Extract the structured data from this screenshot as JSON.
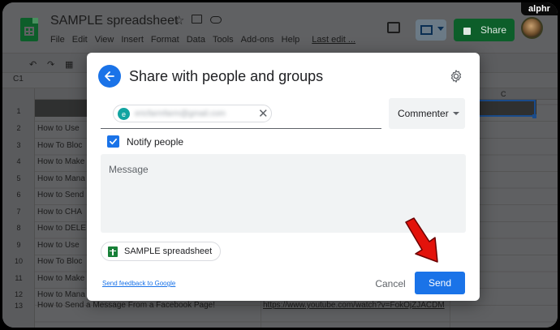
{
  "app": {
    "doc_title": "SAMPLE spreadsheet",
    "menu": [
      "File",
      "Edit",
      "View",
      "Insert",
      "Format",
      "Data",
      "Tools",
      "Add-ons",
      "Help"
    ],
    "last_edit": "Last edit ...",
    "share_label": "Share",
    "cell_ref": "C1",
    "badge": "alphr"
  },
  "sheet": {
    "column_c": "C",
    "rows": [
      {
        "num": "1",
        "text": ""
      },
      {
        "num": "2",
        "text": "How to Use"
      },
      {
        "num": "3",
        "text": "How To Bloc"
      },
      {
        "num": "4",
        "text": "How to Make"
      },
      {
        "num": "5",
        "text": "How to Mana"
      },
      {
        "num": "6",
        "text": "How to Send"
      },
      {
        "num": "7",
        "text": "How to CHA"
      },
      {
        "num": "8",
        "text": "How to DELE"
      },
      {
        "num": "9",
        "text": "How to Use"
      },
      {
        "num": "10",
        "text": "How To Bloc"
      },
      {
        "num": "11",
        "text": "How to Make"
      },
      {
        "num": "12",
        "text": "How to Mana"
      },
      {
        "num": "13",
        "text": "How to Send a Message From a Facebook Page!"
      }
    ],
    "row13_link": "https://www.youtube.com/watch?v=FokOjZJACDM"
  },
  "dialog": {
    "title": "Share with people and groups",
    "recipient": {
      "initial": "e",
      "email": "ericfarmfarm@gmail.com"
    },
    "role": "Commenter",
    "notify_label": "Notify people",
    "notify_checked": true,
    "message_placeholder": "Message",
    "file_name": "SAMPLE spreadsheet",
    "feedback_link": "Send feedback to Google",
    "cancel_label": "Cancel",
    "send_label": "Send"
  },
  "colors": {
    "primary": "#1a73e8",
    "sheets_green": "#188038",
    "annotation_red": "#e3120b"
  }
}
